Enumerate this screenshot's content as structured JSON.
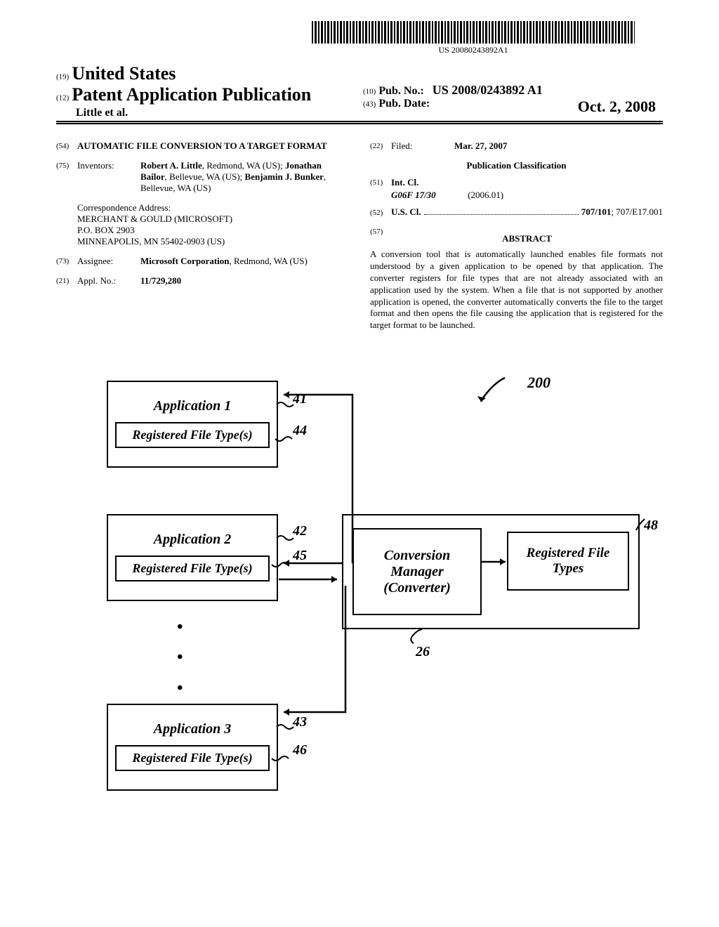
{
  "barcode_text": "US 20080243892A1",
  "country_code": "(19)",
  "country": "United States",
  "pub_type_code": "(12)",
  "pub_type": "Patent Application Publication",
  "authors": "Little et al.",
  "pub_no_code": "(10)",
  "pub_no_label": "Pub. No.:",
  "pub_no": "US 2008/0243892 A1",
  "pub_date_code": "(43)",
  "pub_date_label": "Pub. Date:",
  "pub_date": "Oct. 2, 2008",
  "title_code": "(54)",
  "title": "AUTOMATIC FILE CONVERSION TO A TARGET FORMAT",
  "inventors_code": "(75)",
  "inventors_label": "Inventors:",
  "inventors": "Robert A. Little, Redmond, WA (US); Jonathan Bailor, Bellevue, WA (US); Benjamin J. Bunker, Bellevue, WA (US)",
  "inv1_name": "Robert A. Little",
  "inv1_loc": ", Redmond, WA (US); ",
  "inv2_name": "Jonathan Bailor",
  "inv2_loc": ", Bellevue, WA (US); ",
  "inv3_name": "Benjamin J. Bunker",
  "inv3_loc": ", Bellevue, WA (US)",
  "corr_label": "Correspondence Address:",
  "corr_line1": "MERCHANT & GOULD (MICROSOFT)",
  "corr_line2": "P.O. BOX 2903",
  "corr_line3": "MINNEAPOLIS, MN 55402-0903 (US)",
  "assignee_code": "(73)",
  "assignee_label": "Assignee:",
  "assignee_name": "Microsoft Corporation",
  "assignee_loc": ", Redmond, WA (US)",
  "appl_code": "(21)",
  "appl_label": "Appl. No.:",
  "appl_no": "11/729,280",
  "filed_code": "(22)",
  "filed_label": "Filed:",
  "filed_date": "Mar. 27, 2007",
  "pub_class_heading": "Publication Classification",
  "intcl_code": "(51)",
  "intcl_label": "Int. Cl.",
  "intcl_value": "G06F 17/30",
  "intcl_date": "(2006.01)",
  "uscl_code": "(52)",
  "uscl_label": "U.S. Cl.",
  "uscl_value": "707/101; 707/E17.001",
  "abstract_code": "(57)",
  "abstract_heading": "ABSTRACT",
  "abstract": "A conversion tool that is automatically launched enables file formats not understood by a given application to be opened by that application. The converter registers for file types that are not already associated with an application used by the system. When a file that is not supported by another application is opened, the converter automatically converts the file to the target format and then opens the file causing the application that is registered for the target format to be launched.",
  "fig": {
    "ref_200": "200",
    "app1": "Application 1",
    "app2": "Application 2",
    "app3": "Application 3",
    "reg_file_types": "Registered File Type(s)",
    "conv_mgr_line1": "Conversion",
    "conv_mgr_line2": "Manager",
    "conv_mgr_line3": "(Converter)",
    "reg_types_line1": "Registered File",
    "reg_types_line2": "Types",
    "ref_41": "41",
    "ref_42": "42",
    "ref_43": "43",
    "ref_44": "44",
    "ref_45": "45",
    "ref_46": "46",
    "ref_48": "48",
    "ref_26": "26"
  }
}
